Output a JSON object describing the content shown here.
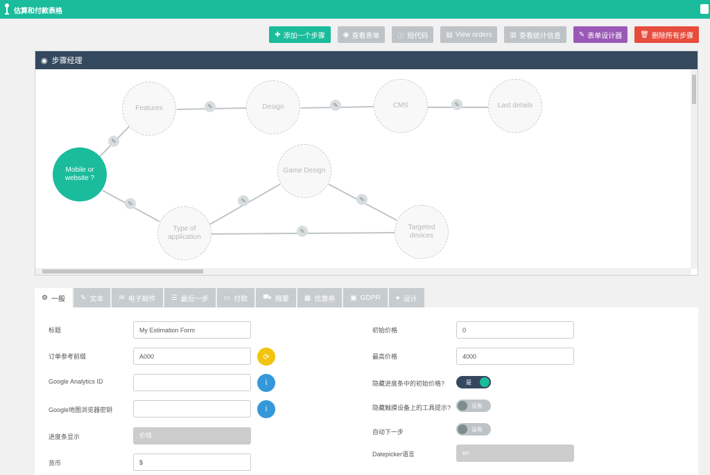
{
  "app": {
    "title": "估算和付款表格"
  },
  "toolbar": {
    "add_step": "添加一个步骤",
    "view_form": "查看表单",
    "shortcode": "短代码",
    "view_orders": "View orders",
    "view_stats": "查看统计信息",
    "form_designer": "表单设计器",
    "delete_all_steps": "删除所有步骤"
  },
  "steps_panel": {
    "title": "步骤经理",
    "nodes": {
      "mobile": "Mobile or website ?",
      "features": "Features",
      "design": "Design",
      "cms": "CMS",
      "last_details": "Last details",
      "game_design": "Game Design",
      "type_app": "Type of application",
      "targeted": "Targeted devices"
    }
  },
  "tabs": [
    "一般",
    "文本",
    "电子邮件",
    "最后一步",
    "付款",
    "摘要",
    "优惠券",
    "GDPR",
    "设计"
  ],
  "form": {
    "title_label": "标题",
    "title_value": "My Estimation Form",
    "order_prefix_label": "订单参考前缀",
    "order_prefix_value": "A000",
    "ga_label": "Google Analytics ID",
    "ga_value": "",
    "gmaps_label": "Google地图浏览器密钥",
    "gmaps_value": "",
    "progress_label": "进度条显示",
    "progress_value": "价钱",
    "currency_label": "货币",
    "currency_value": "$",
    "init_price_label": "初始价格",
    "init_price_value": "0",
    "max_price_label": "最高价格",
    "max_price_value": "4000",
    "hide_init_label": "隐藏进度条中的初始价格?",
    "hide_init_toggle": "是",
    "hide_tooltips_label": "隐藏触摸设备上的工具提示?",
    "hide_tooltips_toggle": "没有",
    "auto_next_label": "自动下一步",
    "auto_next_toggle": "没有",
    "datepicker_label": "Datepicker语言",
    "datepicker_value": "en"
  }
}
